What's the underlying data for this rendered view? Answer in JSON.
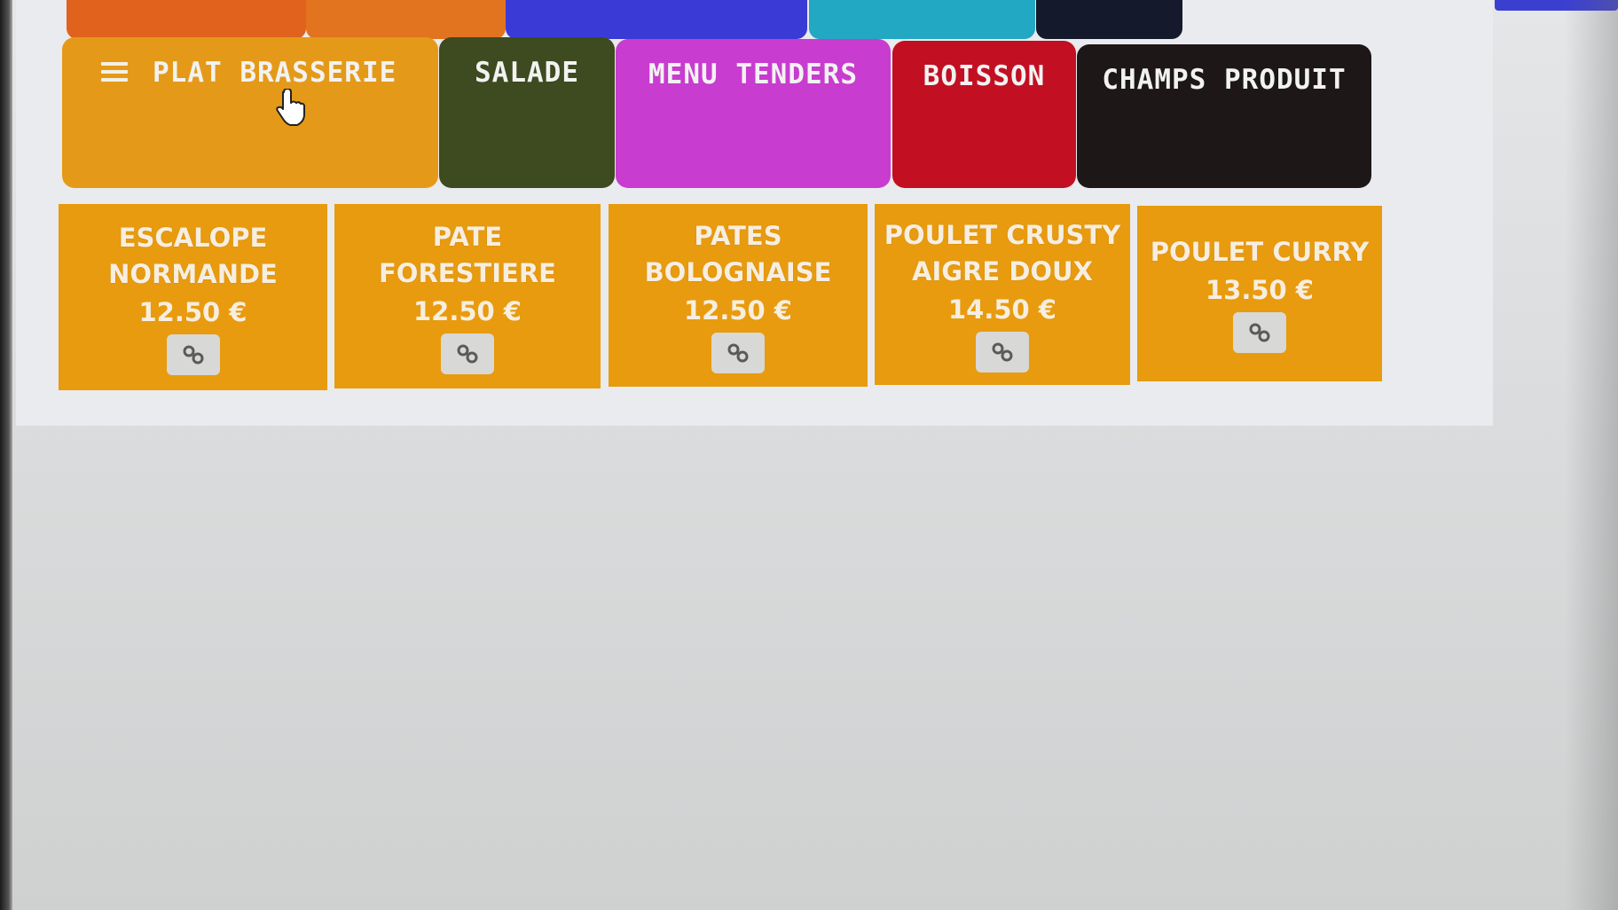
{
  "colors": {
    "plat_brasserie": "#e49a18",
    "salade": "#3e4a1f",
    "menu_tenders": "#c83ccf",
    "boisson": "#c20f22",
    "champs_produit": "#1d1718",
    "tile": "#e89b0e",
    "top_strip": [
      "#e0621d",
      "#e2731f",
      "#3a3bd6",
      "#22a8c2",
      "#141a2c"
    ]
  },
  "categories": [
    {
      "label": "PLAT BRASSERIE",
      "icon": "hamburger-menu-icon"
    },
    {
      "label": "SALADE"
    },
    {
      "label": "MENU TENDERS"
    },
    {
      "label": "BOISSON"
    },
    {
      "label": "CHAMPS PRODUIT"
    }
  ],
  "products": [
    {
      "name_line1": "ESCALOPE",
      "name_line2": "NORMANDE",
      "price": "12.50 €",
      "icon": "link-icon"
    },
    {
      "name_line1": "PATE",
      "name_line2": "FORESTIERE",
      "price": "12.50 €",
      "icon": "link-icon"
    },
    {
      "name_line1": "PATES",
      "name_line2": "BOLOGNAISE",
      "price": "12.50 €",
      "icon": "link-icon"
    },
    {
      "name_line1": "POULET CRUSTY",
      "name_line2": "AIGRE DOUX",
      "price": "14.50 €",
      "icon": "link-icon"
    },
    {
      "name_line1": "POULET CURRY",
      "name_line2": "",
      "price": "13.50 €",
      "icon": "link-icon"
    }
  ],
  "cursor_icon": "hand-pointer-icon"
}
